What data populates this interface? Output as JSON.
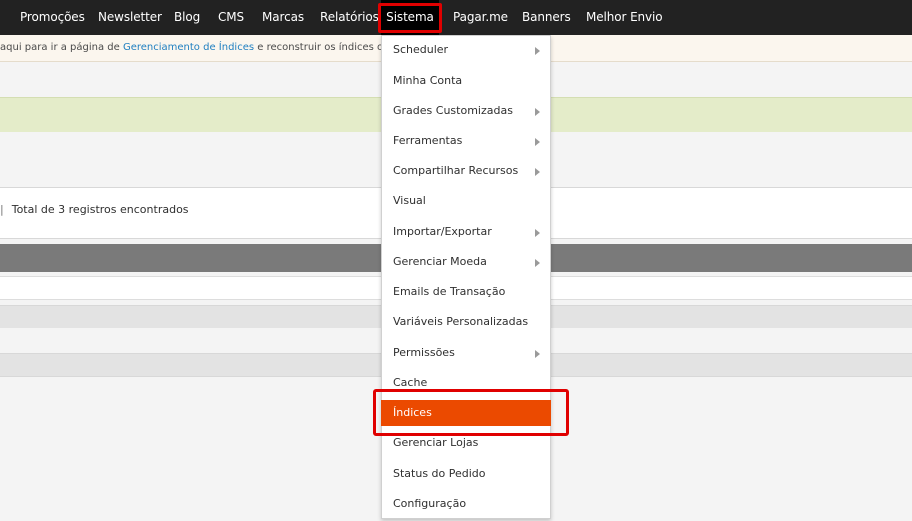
{
  "nav": {
    "items": [
      {
        "label": "Promoções"
      },
      {
        "label": "Newsletter"
      },
      {
        "label": "Blog"
      },
      {
        "label": "CMS"
      },
      {
        "label": "Marcas"
      },
      {
        "label": "Relatórios"
      },
      {
        "label": "Sistema"
      },
      {
        "label": "Pagar.me"
      },
      {
        "label": "Banners"
      },
      {
        "label": "Melhor Envio"
      }
    ],
    "active": "Sistema"
  },
  "notice": {
    "text_before": "aqui para ir a página de ",
    "link": "Gerenciamento de Índices",
    "text_after": " e reconstruir os índices obrigató"
  },
  "records": {
    "separator": "|",
    "total": "Total de 3 registros encontrados"
  },
  "menu": {
    "items": [
      {
        "label": "Scheduler",
        "submenu": true
      },
      {
        "label": "Minha Conta",
        "submenu": false
      },
      {
        "label": "Grades Customizadas",
        "submenu": true
      },
      {
        "label": "Ferramentas",
        "submenu": true
      },
      {
        "label": "Compartilhar Recursos",
        "submenu": true
      },
      {
        "label": "Visual",
        "submenu": false
      },
      {
        "label": "Importar/Exportar",
        "submenu": true
      },
      {
        "label": "Gerenciar Moeda",
        "submenu": true
      },
      {
        "label": "Emails de Transação",
        "submenu": false
      },
      {
        "label": "Variáveis Personalizadas",
        "submenu": false
      },
      {
        "label": "Permissões",
        "submenu": true
      },
      {
        "label": "Cache",
        "submenu": false
      },
      {
        "label": "Índices",
        "submenu": false
      },
      {
        "label": "Gerenciar Lojas",
        "submenu": false
      },
      {
        "label": "Status do Pedido",
        "submenu": false
      },
      {
        "label": "Configuração",
        "submenu": false
      }
    ],
    "selected": "Índices"
  },
  "colors": {
    "nav_bg": "#222222",
    "accent": "#eb4a00",
    "highlight": "#e00000",
    "link": "#1f7fc0"
  }
}
